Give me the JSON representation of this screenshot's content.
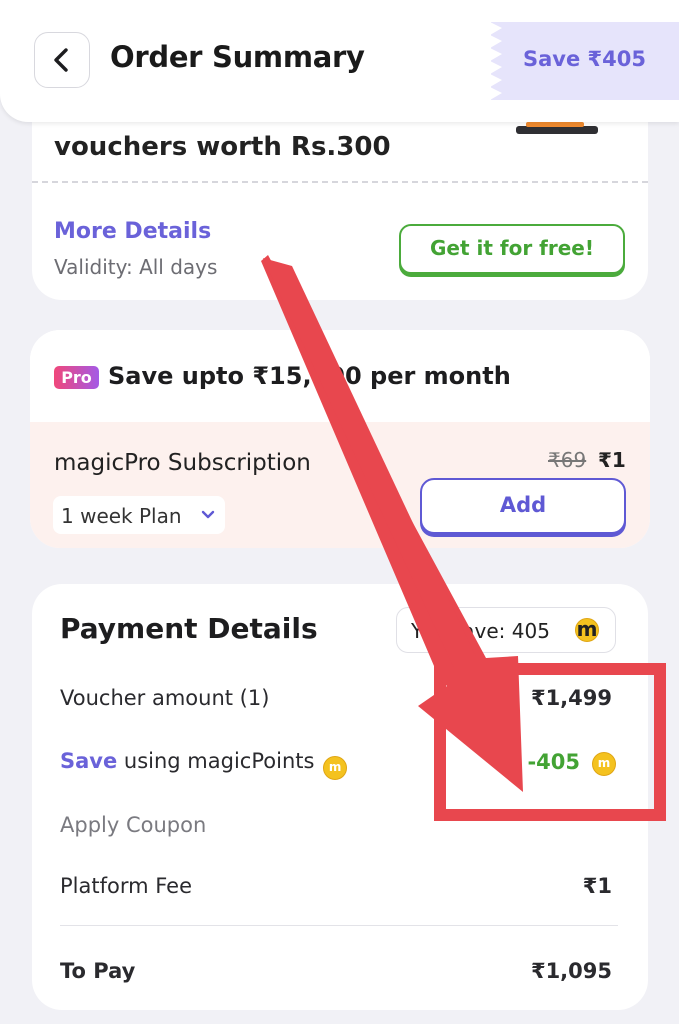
{
  "header": {
    "title": "Order Summary",
    "save_badge": "Save ₹405"
  },
  "voucher_card": {
    "title": "vouchers worth Rs.300",
    "more_details": "More Details",
    "validity": "Validity: All days",
    "cta": "Get it for free!"
  },
  "pro_card": {
    "badge": "Pro",
    "headline": "Save upto ₹15,000 per month",
    "subscription_name": "magicPro Subscription",
    "price_old": "₹69",
    "price_new": "₹1",
    "plan": "1 week Plan",
    "add_label": "Add"
  },
  "payment": {
    "title": "Payment Details",
    "you_save": "You save: 405",
    "coin_letter": "m",
    "rows": {
      "voucher_label": "Voucher amount (1)",
      "voucher_value": "₹1,499",
      "save_word": "Save",
      "save_rest": " using magicPoints",
      "save_value": "-405",
      "coupon_label": "Apply Coupon",
      "platform_label": "Platform Fee",
      "platform_value": "₹1",
      "topay_label": "To Pay",
      "topay_value": "₹1,095"
    }
  },
  "colors": {
    "accent": "#6a62d9",
    "green": "#43a334",
    "annotation_red": "#e8474e",
    "coin": "#f4c21f"
  }
}
